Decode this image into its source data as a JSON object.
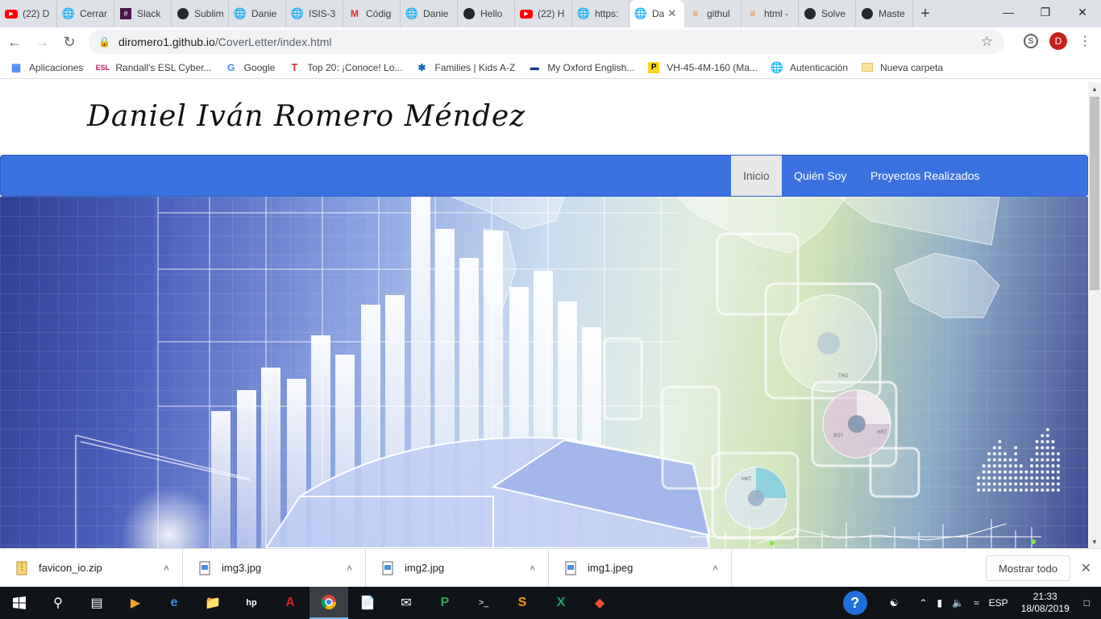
{
  "browser": {
    "tabs": [
      {
        "title": "(22) D",
        "icon": "youtube-icon"
      },
      {
        "title": "Cerrar",
        "icon": "globe-icon"
      },
      {
        "title": "Slack",
        "icon": "slack-icon"
      },
      {
        "title": "Sublim",
        "icon": "github-icon"
      },
      {
        "title": "Danie",
        "icon": "globe-icon"
      },
      {
        "title": "ISIS-3",
        "icon": "globe-icon"
      },
      {
        "title": "Códig",
        "icon": "gmail-icon"
      },
      {
        "title": "Danie",
        "icon": "globe-icon"
      },
      {
        "title": "Hello",
        "icon": "github-icon"
      },
      {
        "title": "(22) H",
        "icon": "youtube-icon"
      },
      {
        "title": "https:",
        "icon": "globe-icon"
      },
      {
        "title": "Da",
        "icon": "globe-icon",
        "active": true
      },
      {
        "title": "githul",
        "icon": "stackoverflow-icon"
      },
      {
        "title": "html -",
        "icon": "stackoverflow-icon"
      },
      {
        "title": "Solve",
        "icon": "github-icon"
      },
      {
        "title": "Maste",
        "icon": "github-icon"
      }
    ],
    "url_host": "diromero1.github.io",
    "url_path": "/CoverLetter/index.html",
    "profile_initial": "D",
    "bookmarks": [
      {
        "label": "Aplicaciones",
        "icon": "apps-grid-icon"
      },
      {
        "label": "Randall's ESL Cyber...",
        "icon": "esl-icon"
      },
      {
        "label": "Google",
        "icon": "google-icon"
      },
      {
        "label": "Top 20: ¡Conoce! Lo...",
        "icon": "top20-icon"
      },
      {
        "label": "Families | Kids A-Z",
        "icon": "kids-az-icon"
      },
      {
        "label": "My Oxford English...",
        "icon": "oxford-icon"
      },
      {
        "label": "VH-45-4M-160 (Ma...",
        "icon": "p-icon"
      },
      {
        "label": "Autenticación",
        "icon": "globe-icon"
      },
      {
        "label": "Nueva carpeta",
        "icon": "folder-icon"
      }
    ]
  },
  "page": {
    "site_title": "Daniel Iván Romero Méndez",
    "nav": [
      {
        "label": "Inicio",
        "active": true
      },
      {
        "label": "Quién Soy"
      },
      {
        "label": "Proyectos Realizados"
      }
    ],
    "hero_chart_labels": [
      "BGY",
      "HRT",
      "TRG",
      "MKT"
    ]
  },
  "downloads": {
    "items": [
      {
        "name": "favicon_io.zip",
        "icon": "zip-icon"
      },
      {
        "name": "img3.jpg",
        "icon": "image-file-icon"
      },
      {
        "name": "img2.jpg",
        "icon": "image-file-icon"
      },
      {
        "name": "img1.jpeg",
        "icon": "image-file-icon"
      }
    ],
    "show_all": "Mostrar todo"
  },
  "taskbar": {
    "lang": "ESP",
    "time": "21:33",
    "date": "18/08/2019"
  },
  "colors": {
    "navbar": "#3a71e0",
    "nav_active_bg": "#e7e7e7"
  }
}
